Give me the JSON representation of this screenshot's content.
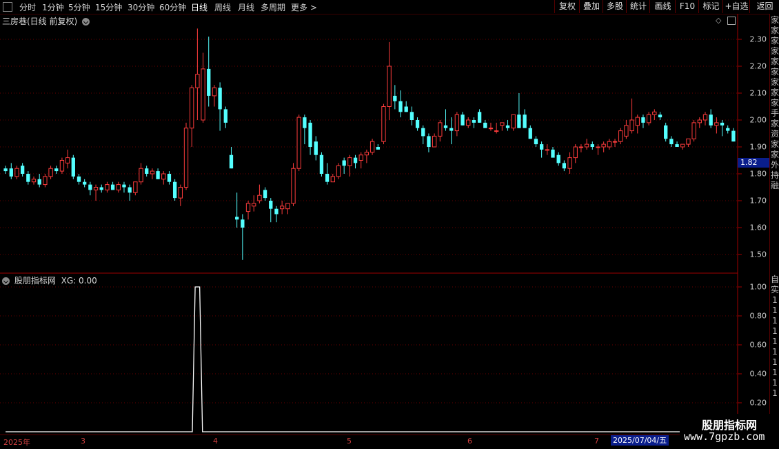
{
  "toolbar": {
    "tabs": [
      {
        "label": "分时"
      },
      {
        "label": "1分钟"
      },
      {
        "label": "5分钟"
      },
      {
        "label": "15分钟"
      },
      {
        "label": "30分钟"
      },
      {
        "label": "60分钟"
      },
      {
        "label": "日线"
      },
      {
        "label": "周线"
      },
      {
        "label": "月线"
      },
      {
        "label": "多周期"
      },
      {
        "label": "更多 >"
      }
    ],
    "active_tab": "日线",
    "right_buttons": [
      {
        "label": "复权"
      },
      {
        "label": "叠加"
      },
      {
        "label": "多股"
      },
      {
        "label": "统计"
      },
      {
        "label": "画线"
      },
      {
        "label": "F10"
      },
      {
        "label": "标记"
      },
      {
        "label": "+自选"
      },
      {
        "label": "返回"
      }
    ]
  },
  "main_panel": {
    "title": "三房巷(日线 前复权)",
    "y_labels": [
      "2.30",
      "2.20",
      "2.10",
      "2.00",
      "1.90",
      "1.80",
      "1.70",
      "1.60",
      "1.50"
    ],
    "current_price": "1.82"
  },
  "indicator_panel": {
    "title": "股朋指标网",
    "value_label": "XG: 0.00",
    "y_labels": [
      "1.00",
      "0.80",
      "0.60",
      "0.40",
      "0.20"
    ]
  },
  "x_axis": {
    "labels": [
      "2025年",
      "3",
      "4",
      "5",
      "6",
      "7"
    ],
    "selected_date": "2025/07/04/五"
  },
  "sidebar_chars": [
    "家",
    "家",
    "家",
    "家",
    "家",
    "家",
    "家",
    "家",
    "家",
    "手",
    "家",
    "资",
    "家",
    "家",
    "外",
    "持",
    "融"
  ],
  "sidebar_chars_lower": [
    "自",
    "实",
    "1",
    "1",
    "1",
    "1",
    "1",
    "1",
    "1",
    "1",
    "1",
    "1"
  ],
  "watermark": {
    "line1": "股朋指标网",
    "line2": "www.7gpzb.com"
  },
  "colors": {
    "up": "#ff3c3c",
    "down": "#54ffff",
    "grid": "#6a0000",
    "border": "#a00000",
    "xg_line": "#ffffff"
  },
  "chart_data": [
    {
      "type": "candlestick",
      "title": "三房巷(日线 前复权)",
      "ylim": [
        1.45,
        2.35
      ],
      "ohlc": [
        [
          1.82,
          1.83,
          1.8,
          1.81
        ],
        [
          1.82,
          1.84,
          1.78,
          1.79
        ],
        [
          1.79,
          1.83,
          1.78,
          1.82
        ],
        [
          1.83,
          1.84,
          1.79,
          1.8
        ],
        [
          1.8,
          1.81,
          1.76,
          1.77
        ],
        [
          1.77,
          1.79,
          1.76,
          1.78
        ],
        [
          1.78,
          1.8,
          1.75,
          1.76
        ],
        [
          1.76,
          1.8,
          1.75,
          1.79
        ],
        [
          1.79,
          1.83,
          1.78,
          1.82
        ],
        [
          1.82,
          1.83,
          1.8,
          1.81
        ],
        [
          1.81,
          1.86,
          1.8,
          1.85
        ],
        [
          1.84,
          1.89,
          1.82,
          1.86
        ],
        [
          1.86,
          1.87,
          1.78,
          1.79
        ],
        [
          1.79,
          1.8,
          1.76,
          1.77
        ],
        [
          1.77,
          1.78,
          1.75,
          1.76
        ],
        [
          1.76,
          1.77,
          1.72,
          1.74
        ],
        [
          1.74,
          1.76,
          1.7,
          1.75
        ],
        [
          1.75,
          1.76,
          1.73,
          1.74
        ],
        [
          1.74,
          1.77,
          1.73,
          1.76
        ],
        [
          1.76,
          1.77,
          1.74,
          1.74
        ],
        [
          1.74,
          1.77,
          1.73,
          1.76
        ],
        [
          1.76,
          1.77,
          1.73,
          1.75
        ],
        [
          1.75,
          1.76,
          1.7,
          1.73
        ],
        [
          1.73,
          1.77,
          1.72,
          1.77
        ],
        [
          1.77,
          1.84,
          1.76,
          1.82
        ],
        [
          1.82,
          1.83,
          1.79,
          1.8
        ],
        [
          1.8,
          1.82,
          1.78,
          1.81
        ],
        [
          1.81,
          1.82,
          1.78,
          1.78
        ],
        [
          1.78,
          1.81,
          1.76,
          1.8
        ],
        [
          1.8,
          1.81,
          1.76,
          1.77
        ],
        [
          1.77,
          1.78,
          1.7,
          1.71
        ],
        [
          1.71,
          1.76,
          1.68,
          1.75
        ],
        [
          1.75,
          1.99,
          1.74,
          1.97
        ],
        [
          1.97,
          2.13,
          1.9,
          2.12
        ],
        [
          2.12,
          2.34,
          2.0,
          2.17
        ],
        [
          2.0,
          2.25,
          1.99,
          2.19
        ],
        [
          2.19,
          2.31,
          2.05,
          2.09
        ],
        [
          2.09,
          2.13,
          2.05,
          2.12
        ],
        [
          2.12,
          2.14,
          1.96,
          2.04
        ],
        [
          2.04,
          2.05,
          1.97,
          1.99
        ],
        [
          1.87,
          1.9,
          1.82,
          1.82
        ],
        [
          1.64,
          1.73,
          1.6,
          1.63
        ],
        [
          1.63,
          1.65,
          1.48,
          1.6
        ],
        [
          1.66,
          1.7,
          1.63,
          1.69
        ],
        [
          1.68,
          1.72,
          1.66,
          1.69
        ],
        [
          1.7,
          1.76,
          1.69,
          1.72
        ],
        [
          1.74,
          1.75,
          1.7,
          1.71
        ],
        [
          1.7,
          1.71,
          1.62,
          1.67
        ],
        [
          1.67,
          1.68,
          1.62,
          1.65
        ],
        [
          1.67,
          1.7,
          1.65,
          1.68
        ],
        [
          1.67,
          1.69,
          1.65,
          1.69
        ],
        [
          1.69,
          1.84,
          1.68,
          1.82
        ],
        [
          1.82,
          2.02,
          1.81,
          2.01
        ],
        [
          2.01,
          2.02,
          1.91,
          1.97
        ],
        [
          1.99,
          2.0,
          1.87,
          1.9
        ],
        [
          1.92,
          1.94,
          1.85,
          1.87
        ],
        [
          1.87,
          1.88,
          1.79,
          1.8
        ],
        [
          1.8,
          1.84,
          1.76,
          1.77
        ],
        [
          1.77,
          1.8,
          1.77,
          1.79
        ],
        [
          1.79,
          1.84,
          1.78,
          1.83
        ],
        [
          1.85,
          1.86,
          1.8,
          1.83
        ],
        [
          1.83,
          1.87,
          1.79,
          1.86
        ],
        [
          1.86,
          1.87,
          1.82,
          1.84
        ],
        [
          1.85,
          1.88,
          1.82,
          1.87
        ],
        [
          1.87,
          1.89,
          1.84,
          1.88
        ],
        [
          1.88,
          1.93,
          1.87,
          1.92
        ],
        [
          1.9,
          1.91,
          1.89,
          1.89
        ],
        [
          1.92,
          2.06,
          1.91,
          2.05
        ],
        [
          2.05,
          2.29,
          2.0,
          2.2
        ],
        [
          2.09,
          2.13,
          2.04,
          2.07
        ],
        [
          2.07,
          2.11,
          2.01,
          2.03
        ],
        [
          2.05,
          2.07,
          2.03,
          2.03
        ],
        [
          2.03,
          2.05,
          1.98,
          2.0
        ],
        [
          2.0,
          2.01,
          1.96,
          1.97
        ],
        [
          1.97,
          1.98,
          1.91,
          1.94
        ],
        [
          1.94,
          1.95,
          1.88,
          1.9
        ],
        [
          1.9,
          1.95,
          1.9,
          1.94
        ],
        [
          1.94,
          2.0,
          1.92,
          1.99
        ],
        [
          1.98,
          2.04,
          1.96,
          1.97
        ],
        [
          1.97,
          2.01,
          1.91,
          1.96
        ],
        [
          1.96,
          2.03,
          1.94,
          2.02
        ],
        [
          2.02,
          2.03,
          1.98,
          1.98
        ],
        [
          1.98,
          2.01,
          1.97,
          2.0
        ],
        [
          2.0,
          2.01,
          1.97,
          1.99
        ],
        [
          2.03,
          2.04,
          1.99,
          1.99
        ],
        [
          1.99,
          2.0,
          1.98,
          1.97
        ],
        [
          1.97,
          1.99,
          1.96,
          1.97
        ],
        [
          1.96,
          1.99,
          1.95,
          1.96
        ],
        [
          1.98,
          1.99,
          1.96,
          1.99
        ],
        [
          1.98,
          2.0,
          1.96,
          1.97
        ],
        [
          1.97,
          2.01,
          1.96,
          2.02
        ],
        [
          2.02,
          2.1,
          1.97,
          1.97
        ],
        [
          2.02,
          2.04,
          1.98,
          1.97
        ],
        [
          1.97,
          1.98,
          1.93,
          1.93
        ],
        [
          1.93,
          1.94,
          1.9,
          1.91
        ],
        [
          1.91,
          1.92,
          1.86,
          1.89
        ],
        [
          1.89,
          1.91,
          1.87,
          1.89
        ],
        [
          1.89,
          1.9,
          1.87,
          1.86
        ],
        [
          1.87,
          1.88,
          1.83,
          1.84
        ],
        [
          1.84,
          1.85,
          1.81,
          1.82
        ],
        [
          1.82,
          1.88,
          1.8,
          1.86
        ],
        [
          1.86,
          1.91,
          1.84,
          1.9
        ],
        [
          1.9,
          1.91,
          1.88,
          1.9
        ],
        [
          1.9,
          1.93,
          1.89,
          1.91
        ],
        [
          1.91,
          1.92,
          1.89,
          1.9
        ],
        [
          1.9,
          1.91,
          1.87,
          1.9
        ],
        [
          1.9,
          1.92,
          1.88,
          1.91
        ],
        [
          1.9,
          1.93,
          1.89,
          1.92
        ],
        [
          1.92,
          1.93,
          1.9,
          1.92
        ],
        [
          1.92,
          1.97,
          1.91,
          1.96
        ],
        [
          1.94,
          2.0,
          1.93,
          1.98
        ],
        [
          1.96,
          2.08,
          1.95,
          2.0
        ],
        [
          1.98,
          2.02,
          1.95,
          2.01
        ],
        [
          2.01,
          2.02,
          1.97,
          1.99
        ],
        [
          1.99,
          2.03,
          1.98,
          2.02
        ],
        [
          2.02,
          2.04,
          2.0,
          2.03
        ],
        [
          2.02,
          2.03,
          2.0,
          2.01
        ],
        [
          1.98,
          1.99,
          1.92,
          1.93
        ],
        [
          1.93,
          1.94,
          1.9,
          1.91
        ],
        [
          1.91,
          1.92,
          1.9,
          1.9
        ],
        [
          1.9,
          1.91,
          1.89,
          1.91
        ],
        [
          1.91,
          1.93,
          1.9,
          1.93
        ],
        [
          1.93,
          2.0,
          1.92,
          1.99
        ],
        [
          1.99,
          2.01,
          1.97,
          2.0
        ],
        [
          2.0,
          2.03,
          1.98,
          2.02
        ],
        [
          2.02,
          2.04,
          1.97,
          1.98
        ],
        [
          1.98,
          2.01,
          1.95,
          1.99
        ],
        [
          1.99,
          2.0,
          1.94,
          1.98
        ],
        [
          1.97,
          1.98,
          1.95,
          1.96
        ],
        [
          1.96,
          1.97,
          1.92,
          1.92
        ]
      ]
    },
    {
      "type": "line",
      "title": "股朋指标网",
      "series": [
        {
          "name": "XG",
          "values": [
            0,
            0,
            0,
            0,
            0,
            0,
            0,
            0,
            0,
            0,
            0,
            0,
            0,
            0,
            0,
            0,
            0,
            0,
            0,
            0,
            0,
            0,
            0,
            0,
            0,
            0,
            0,
            0,
            0,
            0,
            0,
            0,
            0,
            0,
            1,
            0,
            0,
            0,
            0,
            0,
            0,
            0,
            0,
            0,
            0,
            0,
            0,
            0,
            0,
            0,
            0,
            0,
            0,
            0,
            0,
            0,
            0,
            0,
            0,
            0,
            0,
            0,
            0,
            0,
            0,
            0,
            0,
            0,
            0,
            0,
            0,
            0,
            0,
            0,
            0,
            0,
            0,
            0,
            0,
            0,
            0,
            0,
            0,
            0,
            0,
            0,
            0,
            0,
            0,
            0,
            0,
            0,
            0,
            0,
            0,
            0,
            0,
            0,
            0,
            0,
            0,
            0,
            0,
            0,
            0,
            0,
            0,
            0,
            0,
            0,
            0,
            0,
            0,
            0,
            0,
            0,
            0,
            0,
            0,
            0,
            0,
            0,
            0,
            0,
            0,
            0,
            0,
            0,
            0,
            0,
            0,
            0,
            0
          ]
        }
      ],
      "ylim": [
        0,
        1.05
      ]
    }
  ]
}
